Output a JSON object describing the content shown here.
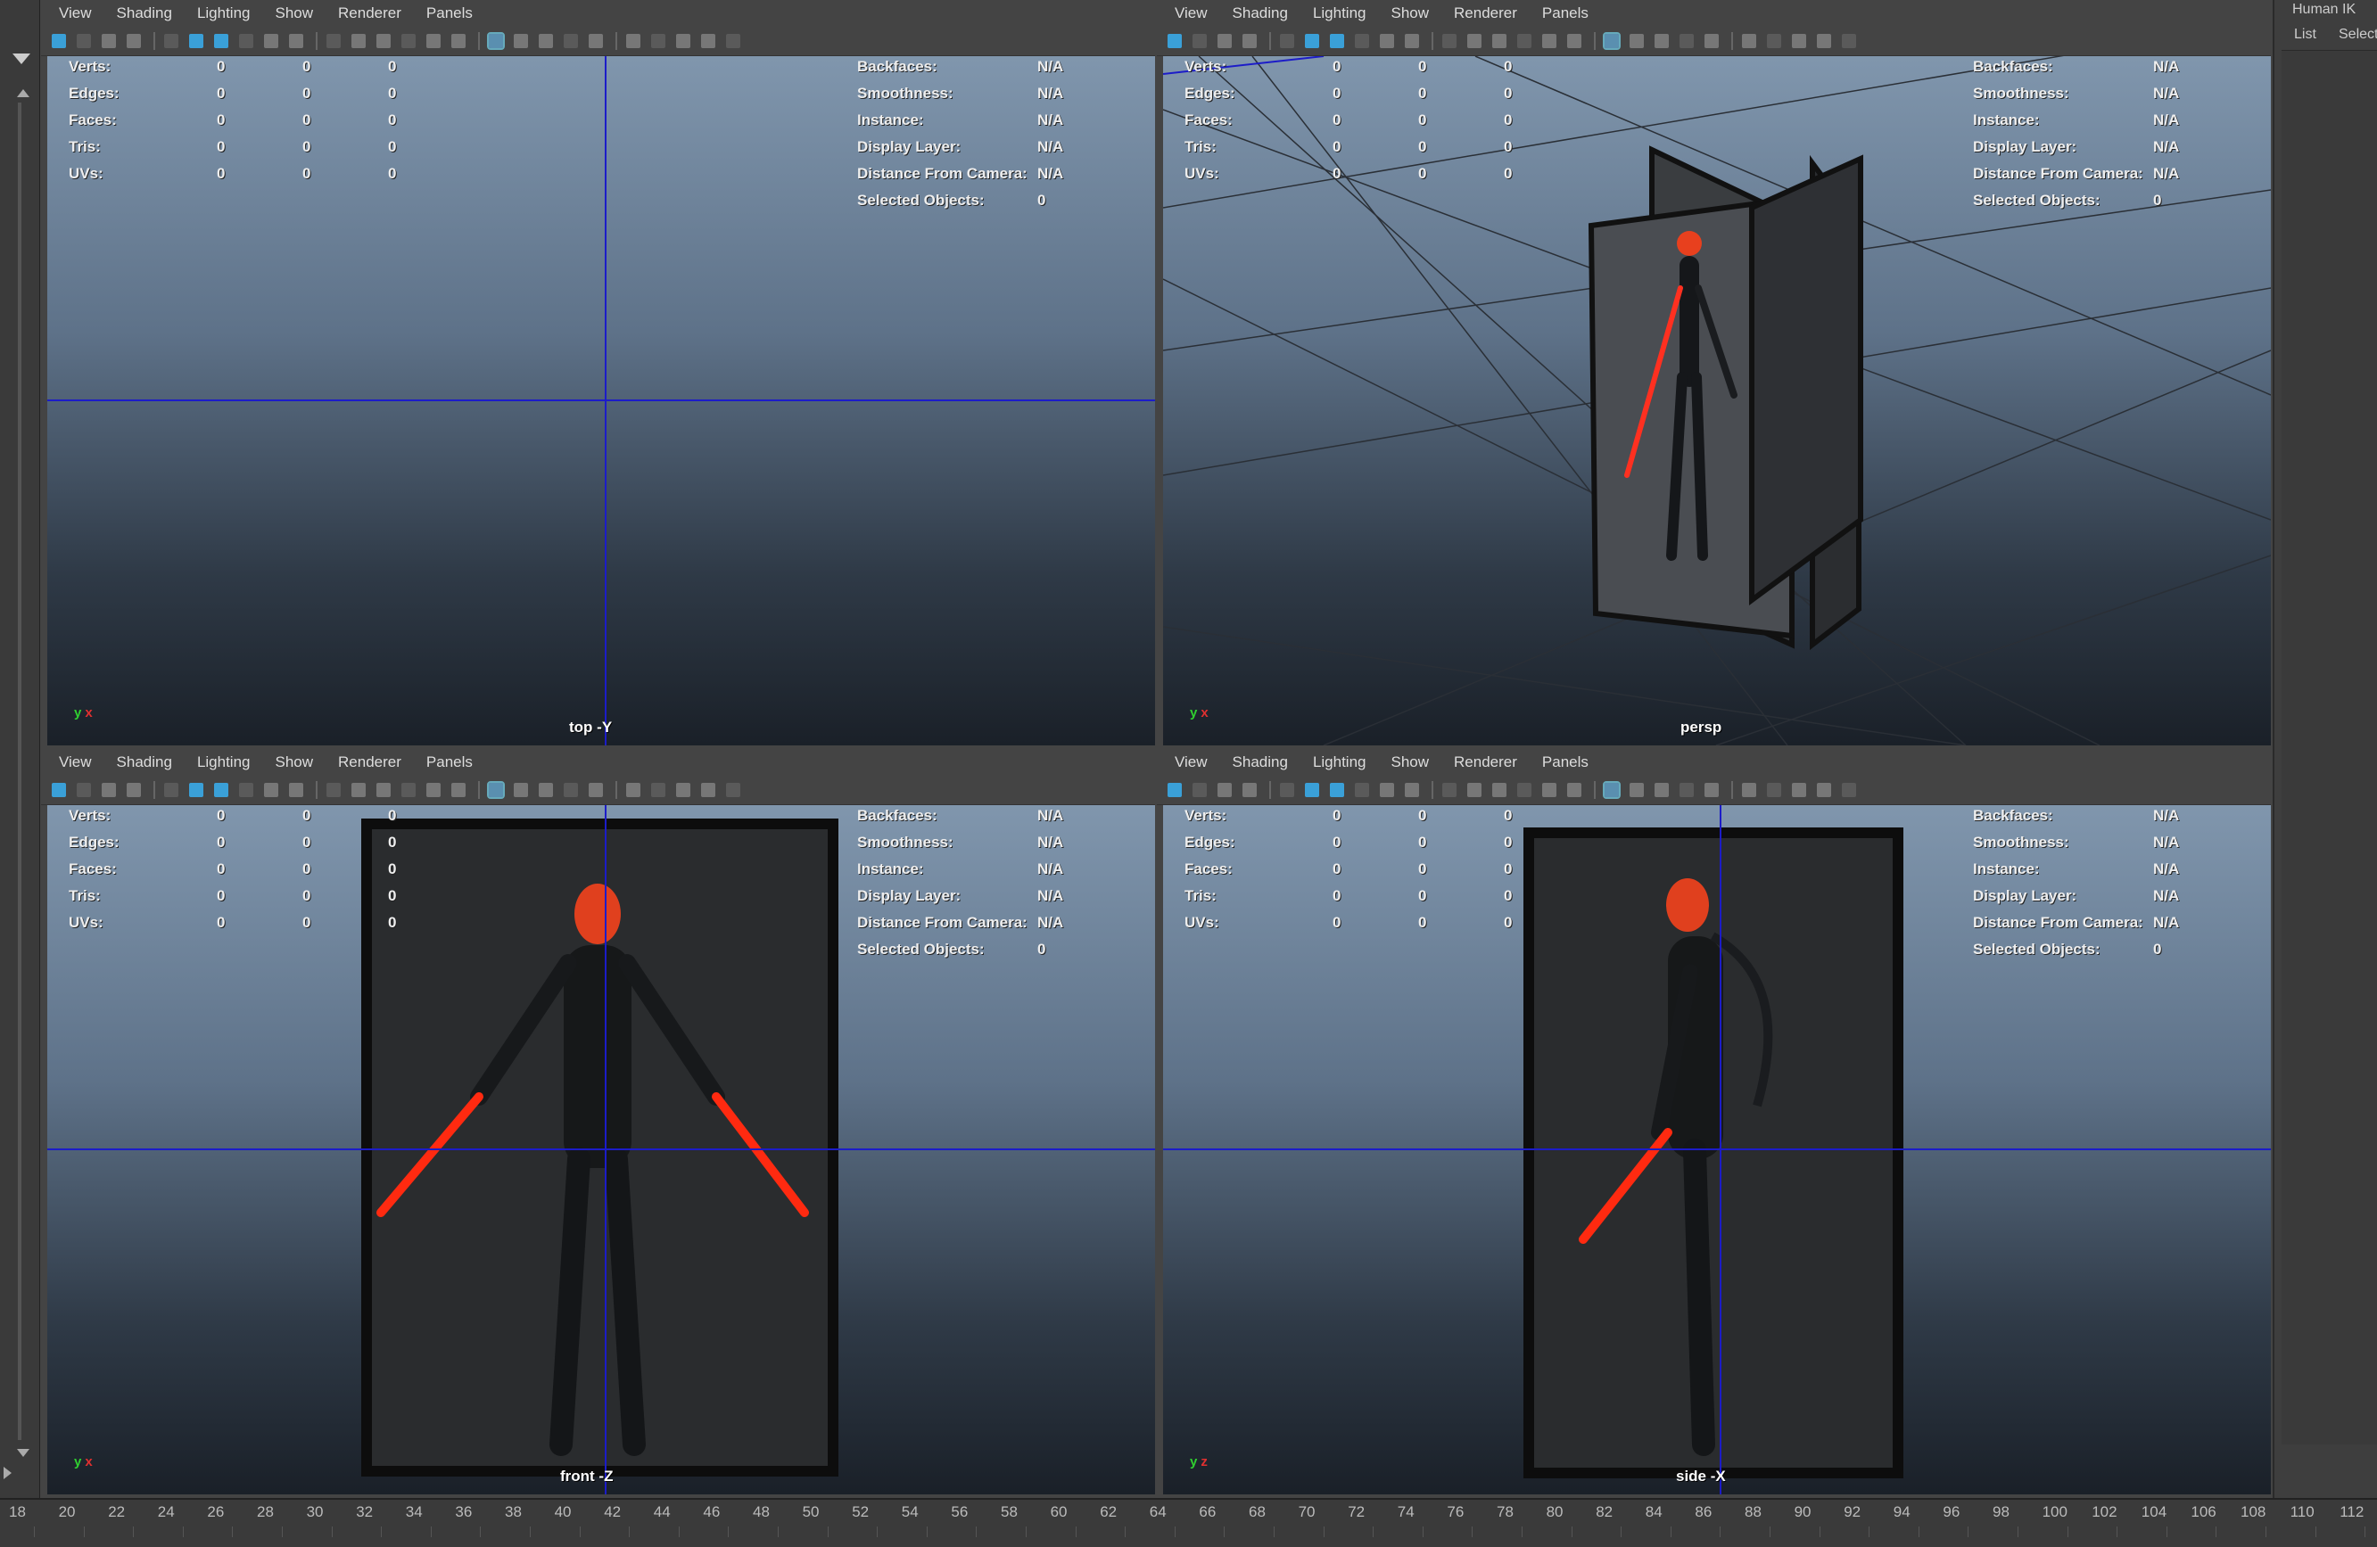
{
  "menus": [
    "View",
    "Shading",
    "Lighting",
    "Show",
    "Renderer",
    "Panels"
  ],
  "hud_left": {
    "rows": [
      {
        "label": "Verts:",
        "v1": "0",
        "v2": "0",
        "v3": "0"
      },
      {
        "label": "Edges:",
        "v1": "0",
        "v2": "0",
        "v3": "0"
      },
      {
        "label": "Faces:",
        "v1": "0",
        "v2": "0",
        "v3": "0"
      },
      {
        "label": "Tris:",
        "v1": "0",
        "v2": "0",
        "v3": "0"
      },
      {
        "label": "UVs:",
        "v1": "0",
        "v2": "0",
        "v3": "0"
      }
    ]
  },
  "hud_right": {
    "rows": [
      {
        "label": "Backfaces:",
        "value": "N/A"
      },
      {
        "label": "Smoothness:",
        "value": "N/A"
      },
      {
        "label": "Instance:",
        "value": "N/A"
      },
      {
        "label": "Display Layer:",
        "value": "N/A"
      },
      {
        "label": "Distance From Camera:",
        "value": "N/A"
      },
      {
        "label": "Selected Objects:",
        "value": "0"
      }
    ]
  },
  "panels": {
    "top": {
      "camera": "top -Y",
      "axis1": "y",
      "axis2": "x"
    },
    "persp": {
      "camera": "persp",
      "axis1": "y",
      "axis2": "x"
    },
    "front": {
      "camera": "front -Z",
      "axis1": "y",
      "axis2": "x"
    },
    "side": {
      "camera": "side -X",
      "axis1": "y",
      "axis2": "z"
    }
  },
  "right_panel": {
    "title": "Human IK",
    "tab_list": "List",
    "tab_selected": "Selecte"
  },
  "timeline_ticks": [
    "18",
    "20",
    "22",
    "24",
    "26",
    "28",
    "30",
    "32",
    "34",
    "36",
    "38",
    "40",
    "42",
    "44",
    "46",
    "48",
    "50",
    "52",
    "54",
    "56",
    "58",
    "60",
    "62",
    "64",
    "66",
    "68",
    "70",
    "72",
    "74",
    "76",
    "78",
    "80",
    "82",
    "84",
    "86",
    "88",
    "90",
    "92",
    "94",
    "96",
    "98",
    "100",
    "102",
    "104",
    "106",
    "108",
    "110",
    "112"
  ],
  "colors": {
    "grid_line": "#1c1cc8",
    "accent": "#3aa0d8",
    "axis_x": "#e03030",
    "axis_y": "#30d030"
  }
}
